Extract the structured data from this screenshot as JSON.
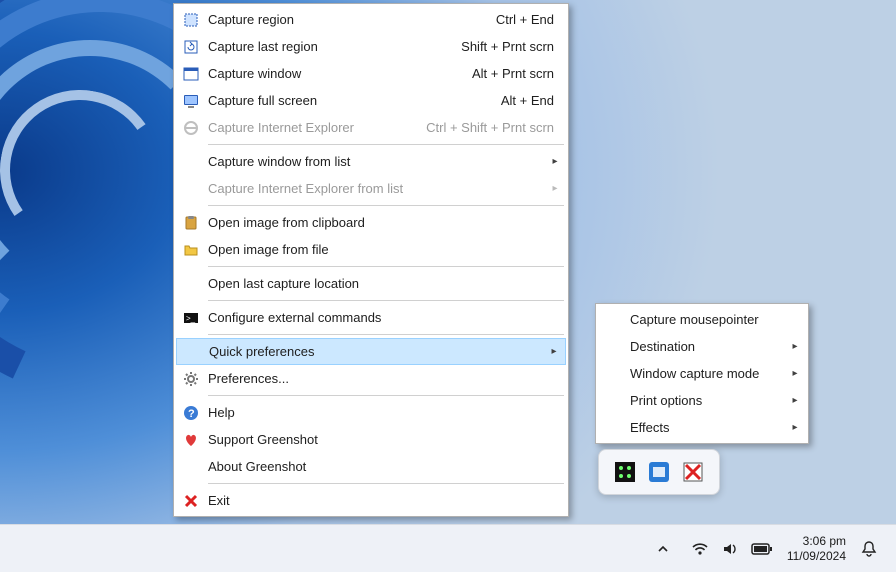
{
  "menu": {
    "capture_region": {
      "label": "Capture region",
      "shortcut": "Ctrl + End"
    },
    "capture_last_region": {
      "label": "Capture last region",
      "shortcut": "Shift + Prnt scrn"
    },
    "capture_window": {
      "label": "Capture window",
      "shortcut": "Alt + Prnt scrn"
    },
    "capture_full_screen": {
      "label": "Capture full screen",
      "shortcut": "Alt + End"
    },
    "capture_ie": {
      "label": "Capture Internet Explorer",
      "shortcut": "Ctrl + Shift + Prnt scrn"
    },
    "capture_window_from_list": {
      "label": "Capture window from list"
    },
    "capture_ie_from_list": {
      "label": "Capture Internet Explorer from list"
    },
    "open_clipboard": {
      "label": "Open image from clipboard"
    },
    "open_file": {
      "label": "Open image from file"
    },
    "open_last_location": {
      "label": "Open last capture location"
    },
    "configure_external": {
      "label": "Configure external commands"
    },
    "quick_preferences": {
      "label": "Quick preferences"
    },
    "preferences": {
      "label": "Preferences..."
    },
    "help": {
      "label": "Help"
    },
    "support": {
      "label": "Support Greenshot"
    },
    "about": {
      "label": "About Greenshot"
    },
    "exit": {
      "label": "Exit"
    }
  },
  "submenu": {
    "capture_mousepointer": {
      "label": "Capture mousepointer"
    },
    "destination": {
      "label": "Destination"
    },
    "window_capture_mode": {
      "label": "Window capture mode"
    },
    "print_options": {
      "label": "Print options"
    },
    "effects": {
      "label": "Effects"
    }
  },
  "clock": {
    "time": "3:06 pm",
    "date": "11/09/2024"
  }
}
